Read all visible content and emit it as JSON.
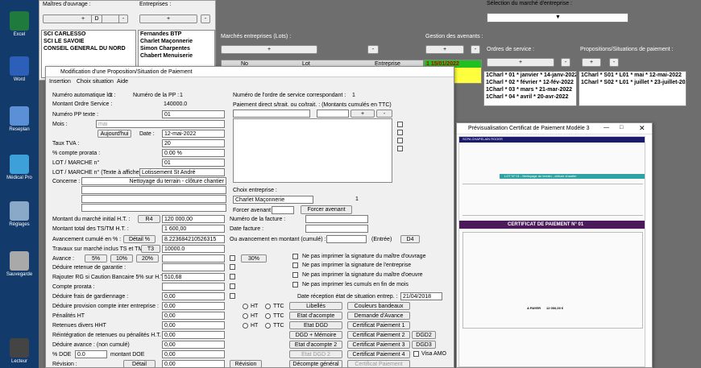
{
  "desktop": {
    "icons": [
      "Excel",
      "Word",
      "Reseplan",
      "Médical Pro",
      "Réglages",
      "Sauvegarde",
      "Lecteur"
    ]
  },
  "top": {
    "maitres_label": "Maîtres d'ouvrage :",
    "entreprises_label": "Entreprises :",
    "plus": "+",
    "minus": "-",
    "d": "D",
    "maitres": [
      "SCI CARLESSO",
      "SCI LE SAVOIE",
      "CONSEIL GENERAL DU NORD"
    ],
    "entreprises": [
      "Fernandes BTP",
      "Charlet Maçonnerie",
      "Simon Charpentes",
      "Chabert Menuiserie"
    ],
    "selection_label": "Sélection du marché d'entreprise :",
    "marches_label": "Marchés entreprises (Lots) :",
    "gestion_label": "Gestion des avenants :",
    "ordres_label": "Ordres de service :",
    "propositions_label": "Propositions/Situations de paiement :",
    "lots_headers": [
      "No",
      "Lot",
      "Entreprise"
    ],
    "avenants": [
      "1 15/01/2022"
    ],
    "ordres": [
      "1Charl * 01 * janvier * 14-janv-2022",
      "1Charl * 02 * février * 12-fév-2022",
      "1Charl * 03 * mars * 21-mar-2022",
      "1Charl * 04 * avril * 20-avr-2022"
    ],
    "propositions": [
      "1Charl * S01 * L01 * mai * 12-mai-2022",
      "1Charl * S02 * L01 * juillet * 23-juillet-2022"
    ]
  },
  "dialog": {
    "title": "Modification d'une Proposition/Situation de Paiement",
    "menu": [
      "Insertion",
      "Choix situation",
      "Aide"
    ],
    "num_auto": "Numéro automatique lot :",
    "num_auto_val": "1",
    "num_pp": "Numéro de la PP :",
    "num_pp_val": "1",
    "num_ordre": "Numéro de l'ordre de service correspondant :",
    "num_ordre_val": "1",
    "montant_os": "Montant Ordre Service :",
    "montant_os_val": "140000.0",
    "num_pp_texte": "Numéro PP texte :",
    "num_pp_texte_val": "01",
    "mois": "Mois :",
    "mois_val": "mai",
    "aujourdhui": "Aujourd'hui",
    "date_label": "Date :",
    "date_val": "12-mai-2022",
    "taux_tva": "Taux TVA :",
    "taux_tva_val": "20",
    "pct_prorata": "% compte prorata :",
    "pct_prorata_val": "0.00 %",
    "lot_marche": "LOT / MARCHE n°",
    "lot_marche_val": "01",
    "lot_texte": "LOT / MARCHE n° (Texte à afficher)",
    "lot_texte_val": "Lotissement St André",
    "concerne": "Concerne :",
    "concerne_val": "Nettoyage du terrain - clôture chantier",
    "paiement_direct": "Paiement direct s/trait. ou co/trait. : (Montants cumulés en TTC)",
    "choix_entreprise": "Choix entreprise :",
    "entreprise_val": "Charlet Maçonnerie",
    "entreprise_num": "1",
    "forcer_avenant": "Forcer avenant :",
    "forcer_btn": "Forcer avenant",
    "m_initial": "Montant du marché initial H.T. :",
    "r4": "R4",
    "m_initial_val": "120 000,00",
    "m_total": "Montant total des TS/TM H.T. :",
    "m_total_val": "1 600,00",
    "num_facture": "Numéro de la facture :",
    "date_facture": "Date facture :",
    "avancement": "Avancement cumulé en % :",
    "detail_pct": "Détail %",
    "avancement_val": "8.223684210526315",
    "ou_avancement": "Ou avancement en montant (cumulé) :",
    "entree": "(Entrée)",
    "d4": "D4",
    "travaux_sup": "Travaux sur marché inclus TS et TM :",
    "t3": "T3",
    "travaux_val": "10000.0",
    "avance": "Avance :",
    "p5": "5%",
    "p10": "10%",
    "p20": "20%",
    "p30": "30%",
    "retenue_garantie": "Déduire retenue de garantie :",
    "rg": "Rajouter RG si Caution Bancaire 5% sur H.T. :",
    "rg_val": "510,68",
    "compte_prorata": "Compte prorata :",
    "frais_gardiennage": "Déduire frais de gardiennage :",
    "provision": "Déduire provision compte inter entreprise :",
    "penalites": "Pénalités HT",
    "retenues": "Retenues divers HHT",
    "reintegration": "Réintégration de retenues ou pénalités H.T. :",
    "deduire_avance": "Déduire avance : (non cumulé)",
    "pct_doe": "% DOE",
    "pct_doe_val": "0.0",
    "montant_doe": "montant DOE",
    "zero": "0,00",
    "revision": "Révision :",
    "detail": "Détail",
    "revision_btn": "Révision",
    "ht": "HT",
    "ttc": "TTC",
    "chk": [
      "Ne pas imprimer la signature du maître d'ouvrage",
      "Ne pas imprimer la signature de l'entreprise",
      "Ne pas imprimer la signature du maître d'oeuvre",
      "Ne pas imprimer les cumuls en fin de mois"
    ],
    "date_reception": "Date réception état de situation entrep. :",
    "date_reception_val": "21/04/2018",
    "libelles": "Libellés",
    "couleurs": "Couleurs bandeaux",
    "etat_acompte": "Etat d'acompte",
    "demande_avance": "Demande d'Avance",
    "etat_dgd": "Etat DGD",
    "cert1": "Certificat Paiement 1",
    "dgd_memoire": "DGD + Mémoire",
    "cert2": "Certificat Paiement 2",
    "dgd2": "DGD2",
    "etat_acompte2": "Etat d'acompte 2",
    "cert3": "Certificat Paiement 3",
    "dgd3": "DGD3",
    "etat_dgd2": "Etat DGD 2",
    "cert4": "Certificat Paiement 4",
    "visa_amo": "Visa AMO",
    "decompte": "Décompte général",
    "cert_paiement": "Certificat Paiement"
  },
  "preview": {
    "title": "Prévisualisation Certificat de Paiement Modèle 3",
    "header": "SCPA CHAPELAIN ROGER",
    "doc_title": "CERTIFICAT DE PAIEMENT N° 01",
    "lot_line": "LOT N° 01 - Nettoyage du terrain - clôture chantier",
    "a_payer": "A PAYER",
    "a_payer_val": "12 000,00 €"
  }
}
